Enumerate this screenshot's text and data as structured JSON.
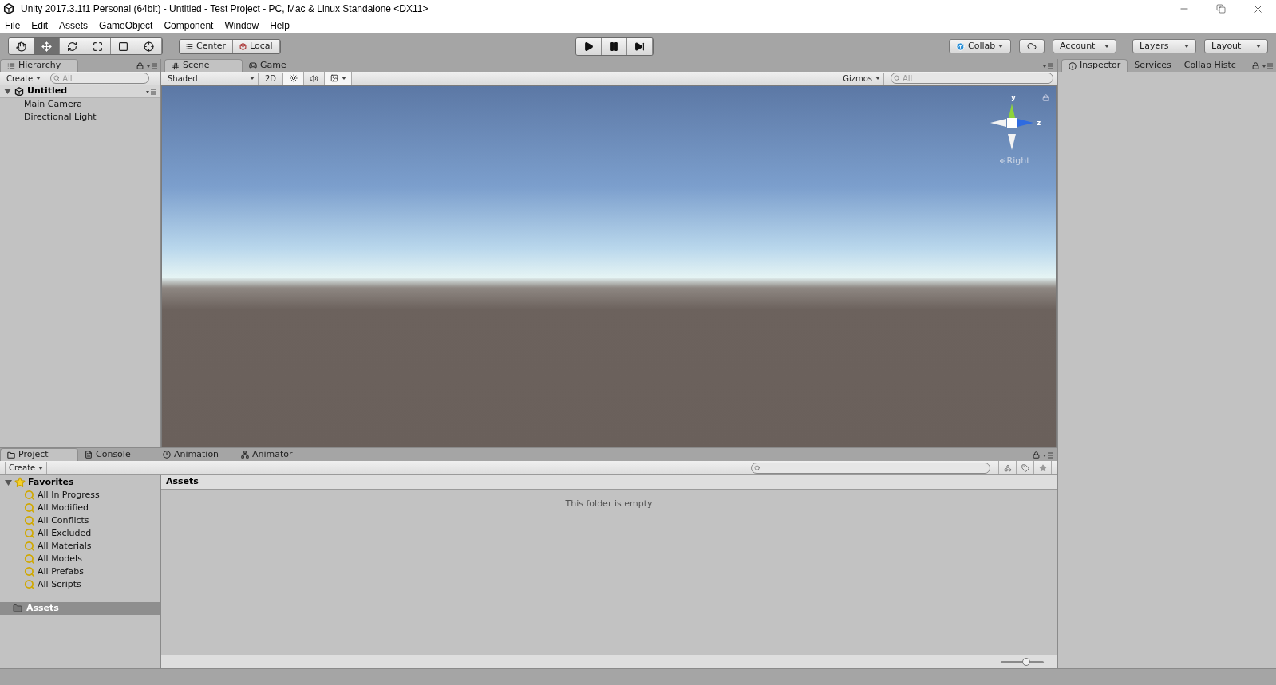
{
  "window": {
    "title": "Unity 2017.3.1f1 Personal (64bit) - Untitled - Test Project - PC, Mac & Linux Standalone <DX11>"
  },
  "menu": [
    "File",
    "Edit",
    "Assets",
    "GameObject",
    "Component",
    "Window",
    "Help"
  ],
  "tools": [
    {
      "kind": "hand",
      "selected": false
    },
    {
      "kind": "move",
      "selected": true
    },
    {
      "kind": "rotate",
      "selected": false
    },
    {
      "kind": "scale",
      "selected": false
    },
    {
      "kind": "rect",
      "selected": false
    },
    {
      "kind": "transform",
      "selected": false
    }
  ],
  "pivot": [
    {
      "kind": "center",
      "label": "Center"
    },
    {
      "kind": "local",
      "label": "Local"
    }
  ],
  "playback": [
    {
      "kind": "play",
      "selected": false
    },
    {
      "kind": "pause",
      "selected": false
    },
    {
      "kind": "step",
      "selected": false
    }
  ],
  "top_right": {
    "collab": "Collab",
    "account": "Account",
    "layers": "Layers",
    "layout": "Layout"
  },
  "hierarchy": {
    "tab": "Hierarchy",
    "create": "Create",
    "search_placeholder": "All",
    "scene": {
      "name": "Untitled",
      "expanded": true,
      "children": [
        {
          "name": "Main Camera"
        },
        {
          "name": "Directional Light"
        }
      ]
    }
  },
  "scene": {
    "tabs": [
      {
        "kind": "scene",
        "label": "Scene",
        "selected": true
      },
      {
        "kind": "game",
        "label": "Game",
        "selected": false
      }
    ],
    "shading": "Shaded",
    "mode_2d": {
      "label": "2D",
      "on": false
    },
    "lighting_on": true,
    "audio_on": false,
    "effects_on": true,
    "gizmos": "Gizmos",
    "search_placeholder": "All",
    "gizmo_labels": {
      "y": "y",
      "z": "z",
      "view": "Right"
    }
  },
  "inspector": {
    "tabs": [
      {
        "kind": "inspector",
        "label": "Inspector",
        "selected": true
      },
      {
        "kind": "services",
        "label": "Services",
        "selected": false
      },
      {
        "kind": "history",
        "label": "Collab Histc",
        "selected": false
      }
    ]
  },
  "project": {
    "tabs": [
      {
        "kind": "project",
        "label": "Project",
        "selected": true
      },
      {
        "kind": "console",
        "label": "Console",
        "selected": false
      },
      {
        "kind": "animation",
        "label": "Animation",
        "selected": false
      },
      {
        "kind": "animator",
        "label": "Animator",
        "selected": false
      }
    ],
    "create": "Create",
    "favorites": {
      "name": "Favorites",
      "expanded": true,
      "children": [
        {
          "name": "All In Progress"
        },
        {
          "name": "All Modified"
        },
        {
          "name": "All Conflicts"
        },
        {
          "name": "All Excluded"
        },
        {
          "name": "All Materials"
        },
        {
          "name": "All Models"
        },
        {
          "name": "All Prefabs"
        },
        {
          "name": "All Scripts"
        }
      ]
    },
    "folders": [
      {
        "name": "Assets",
        "selected": true
      }
    ],
    "breadcrumb": "Assets",
    "empty_message": "This folder is empty",
    "zoom": {
      "level": 0.6
    }
  }
}
